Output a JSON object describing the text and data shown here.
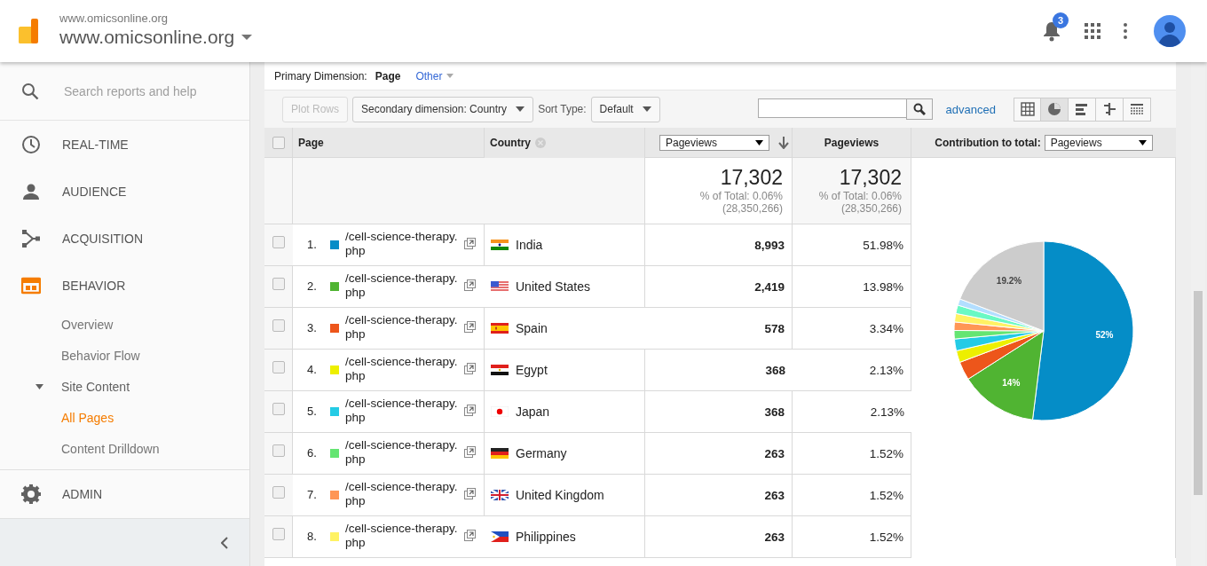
{
  "header": {
    "site_small": "www.omicsonline.org",
    "site_title": "www.omicsonline.org",
    "notification_count": "3"
  },
  "sidebar": {
    "search_placeholder": "Search reports and help",
    "items": [
      {
        "label": "REAL-TIME",
        "selected": false
      },
      {
        "label": "AUDIENCE",
        "selected": false
      },
      {
        "label": "ACQUISITION",
        "selected": false
      },
      {
        "label": "BEHAVIOR",
        "selected": true,
        "children": [
          {
            "label": "Overview",
            "selected": false
          },
          {
            "label": "Behavior Flow",
            "selected": false
          },
          {
            "label": "Site Content",
            "selected": false,
            "expanded": true,
            "children": [
              {
                "label": "All Pages",
                "selected": true
              },
              {
                "label": "Content Drilldown",
                "selected": false
              }
            ]
          }
        ]
      }
    ],
    "admin": "ADMIN"
  },
  "primary_dimension": {
    "label": "Primary Dimension:",
    "options": [
      {
        "label": "Page",
        "selected": true
      },
      {
        "label": "Other",
        "selected": false
      }
    ]
  },
  "toolbar": {
    "plot_rows": "Plot Rows",
    "plot_rows_disabled": true,
    "secondary_dimension": "Secondary dimension: Country",
    "sort_label": "Sort Type:",
    "sort_value": "Default",
    "advanced": "advanced",
    "view_buttons": [
      {
        "kind": "table",
        "selected": false
      },
      {
        "kind": "pie",
        "selected": true
      },
      {
        "kind": "bars",
        "selected": false
      },
      {
        "kind": "comparison",
        "selected": false
      },
      {
        "kind": "pivot",
        "selected": false
      }
    ]
  },
  "table": {
    "select_all_checked": false,
    "columns": {
      "page": "Page",
      "country": "Country",
      "metric_select": "Pageviews",
      "pageviews": "Pageviews",
      "contribution_label": "Contribution to total:",
      "contribution_select": "Pageviews"
    },
    "totals": [
      {
        "value": "17,302",
        "percent": "% of Total: 0.06%",
        "total": "(28,350,266)"
      },
      {
        "value": "17,302",
        "percent": "% of Total: 0.06%",
        "total": "(28,350,266)"
      }
    ],
    "rows": [
      {
        "checked": false,
        "rank": "1.",
        "color": "#058dc7",
        "page": "/cell-science-therapy.php",
        "country": "India",
        "pageviews": "8,993",
        "share": "51.98%"
      },
      {
        "checked": false,
        "rank": "2.",
        "color": "#50b432",
        "page": "/cell-science-therapy.php",
        "country": "United States",
        "pageviews": "2,419",
        "share": "13.98%"
      },
      {
        "checked": false,
        "rank": "3.",
        "color": "#ed561b",
        "page": "/cell-science-therapy.php",
        "country": "Spain",
        "pageviews": "578",
        "share": "3.34%"
      },
      {
        "checked": false,
        "rank": "4.",
        "color": "#edef00",
        "page": "/cell-science-therapy.php",
        "country": "Egypt",
        "pageviews": "368",
        "share": "2.13%"
      },
      {
        "checked": false,
        "rank": "5.",
        "color": "#24cbe5",
        "page": "/cell-science-therapy.php",
        "country": "Japan",
        "pageviews": "368",
        "share": "2.13%"
      },
      {
        "checked": false,
        "rank": "6.",
        "color": "#64e572",
        "page": "/cell-science-therapy.php",
        "country": "Germany",
        "pageviews": "263",
        "share": "1.52%"
      },
      {
        "checked": false,
        "rank": "7.",
        "color": "#ff9655",
        "page": "/cell-science-therapy.php",
        "country": "United Kingdom",
        "pageviews": "263",
        "share": "1.52%"
      },
      {
        "checked": false,
        "rank": "8.",
        "color": "#fff263",
        "page": "/cell-science-therapy.php",
        "country": "Philippines",
        "pageviews": "263",
        "share": "1.52%"
      }
    ],
    "chart_data": {
      "type": "pie",
      "values": [
        51.98,
        13.98,
        3.34,
        2.13,
        2.13,
        1.52,
        1.52,
        1.52,
        1.52,
        1.16,
        19.2
      ],
      "colors": [
        "#058dc7",
        "#50b432",
        "#ed561b",
        "#edef00",
        "#24cbe5",
        "#64e572",
        "#ff9655",
        "#fff263",
        "#6af9c4",
        "#b2deff",
        "#cccccc"
      ],
      "value_labels": [
        "52%",
        "14%",
        null,
        null,
        null,
        null,
        null,
        null,
        null,
        null,
        "19.2%"
      ]
    }
  }
}
